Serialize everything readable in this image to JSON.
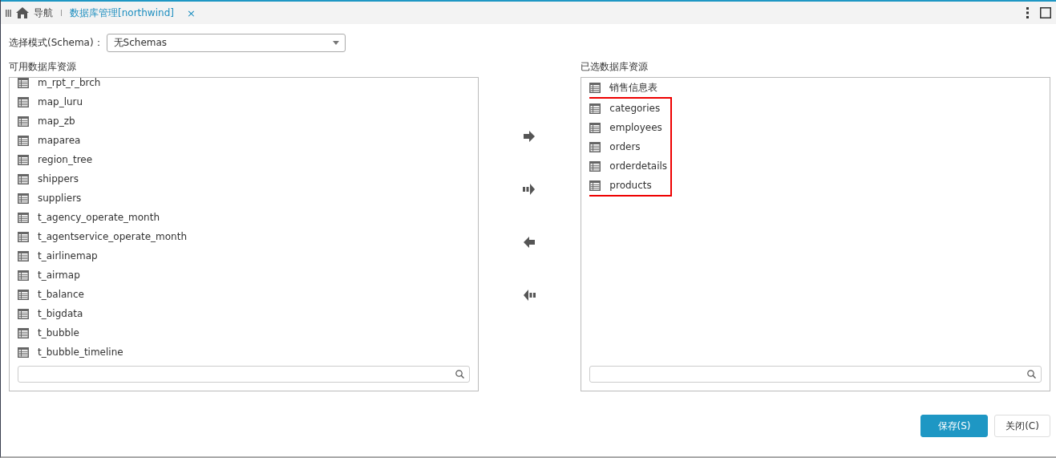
{
  "tabs": [
    {
      "label": "导航",
      "kind": "home",
      "selected": false
    },
    {
      "label": "数据库管理[northwind]",
      "kind": "doc",
      "selected": true,
      "close": "×"
    }
  ],
  "schema": {
    "label": "选择模式(Schema)：",
    "value": "无Schemas"
  },
  "available": {
    "title": "可用数据库资源",
    "items": [
      "m_rpt_r_brch",
      "map_luru",
      "map_zb",
      "maparea",
      "region_tree",
      "shippers",
      "suppliers",
      "t_agency_operate_month",
      "t_agentservice_operate_month",
      "t_airlinemap",
      "t_airmap",
      "t_balance",
      "t_bigdata",
      "t_bubble",
      "t_bubble_timeline"
    ]
  },
  "selected": {
    "title": "已选数据库资源",
    "items": [
      {
        "label": "销售信息表",
        "highlighted": false
      },
      {
        "label": "categories",
        "highlighted": true
      },
      {
        "label": "employees",
        "highlighted": true
      },
      {
        "label": "orders",
        "highlighted": true
      },
      {
        "label": "orderdetails",
        "highlighted": true
      },
      {
        "label": "products",
        "highlighted": true
      }
    ]
  },
  "buttons": [
    {
      "label": "保存(S)",
      "kind": "primary"
    },
    {
      "label": "关闭(C)",
      "kind": "default"
    }
  ]
}
